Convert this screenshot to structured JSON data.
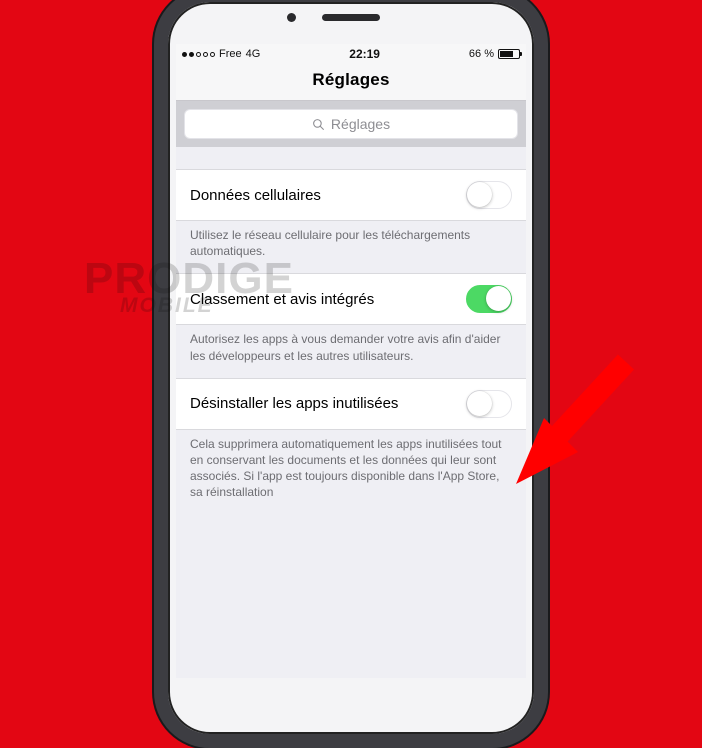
{
  "statusbar": {
    "carrier": "Free",
    "network": "4G",
    "time": "22:19",
    "battery_pct": "66 %"
  },
  "nav": {
    "title": "Réglages"
  },
  "search": {
    "placeholder": "Réglages"
  },
  "rows": {
    "cellular": {
      "label": "Données cellulaires",
      "footer": "Utilisez le réseau cellulaire pour les téléchargements automatiques."
    },
    "ratings": {
      "label": "Classement et avis intégrés",
      "footer": "Autorisez les apps à vous demander votre avis afin d'aider les développeurs et les autres utilisateurs."
    },
    "offload": {
      "label": "Désinstaller les apps inutilisées",
      "footer": "Cela supprimera automatiquement les apps inutilisées tout en conservant les documents et les données qui leur sont associés. Si l'app est toujours disponible dans l'App Store, sa réinstallation"
    }
  },
  "watermark": {
    "line1": "PRODIGE",
    "line2": "MOBILE"
  },
  "colors": {
    "accent_green": "#4cd964",
    "bg_red": "#e30613"
  }
}
